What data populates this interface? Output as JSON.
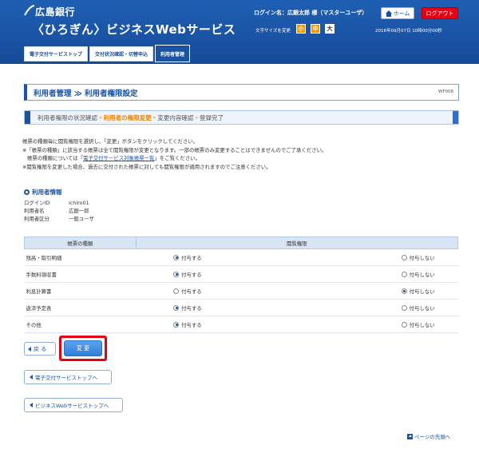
{
  "header": {
    "bank_name": "広島銀行",
    "service_name": "〈ひろぎん〉ビジネスWebサービス",
    "login_name": "ログイン名：広銀太郎 様（マスターユーザ）",
    "home_label": "ホーム",
    "logout_label": "ログアウト",
    "fontsize_label": "文字サイズを変更",
    "fontsize_small": "小",
    "fontsize_medium": "中",
    "fontsize_large": "大",
    "datetime": "2016年09月07日 10時00分00秒",
    "accent_color": "#1a53a4",
    "logout_color": "#e60012"
  },
  "nav": {
    "tabs": [
      {
        "label": "電子交付サービストップ"
      },
      {
        "label": "交付状況確認・切替申込"
      },
      {
        "label": "利用者管理"
      }
    ]
  },
  "page": {
    "title": "利用者管理 ≫ 利用者権限設定",
    "screen_id": "WF008"
  },
  "steps": [
    {
      "label": "利用者権限の状況確認"
    },
    {
      "label": "利用者の権限変更"
    },
    {
      "label": "変更内容確認"
    },
    {
      "label": "登録完了"
    }
  ],
  "notes": {
    "line1": "帳票の種類毎に閲覧権限を選択し、「変更」ボタンをクリックしてください。",
    "line2": "※「帳票の種類」に該当する帳票は全て閲覧権限が変更となります。一部の帳票のみ変更することはできませんのでご了承ください。",
    "line3_pre": "帳票の種類については「",
    "line3_link": "電子交付サービス対象帳票一覧",
    "line3_post": "」をご覧ください。",
    "line4": "※閲覧権限を変更した場合、過去に交付された帳票に対しても閲覧権限が適用されますのでご注意ください。"
  },
  "user_info": {
    "heading": "利用者情報",
    "rows": [
      {
        "label": "ログインID",
        "value": "ichiro01"
      },
      {
        "label": "利用者名",
        "value": "広銀一郎"
      },
      {
        "label": "利用者区分",
        "value": "一般ユーザ"
      }
    ]
  },
  "table": {
    "col_type": "帳票の種類",
    "col_perm": "閲覧権限",
    "grant_label": "付与する",
    "deny_label": "付与しない",
    "rows": [
      {
        "name": "残高・取引明細",
        "grant": true
      },
      {
        "name": "手数料領収書",
        "grant": true
      },
      {
        "name": "利息計算書",
        "grant": false
      },
      {
        "name": "返済予定表",
        "grant": true
      },
      {
        "name": "その他",
        "grant": true
      }
    ]
  },
  "buttons": {
    "back": "戻 る",
    "change": "変 更",
    "to_top": "電子交付サービストップへ",
    "to_biz": "ビジネスWebサービストップへ",
    "page_top": "ページの先頭へ"
  }
}
